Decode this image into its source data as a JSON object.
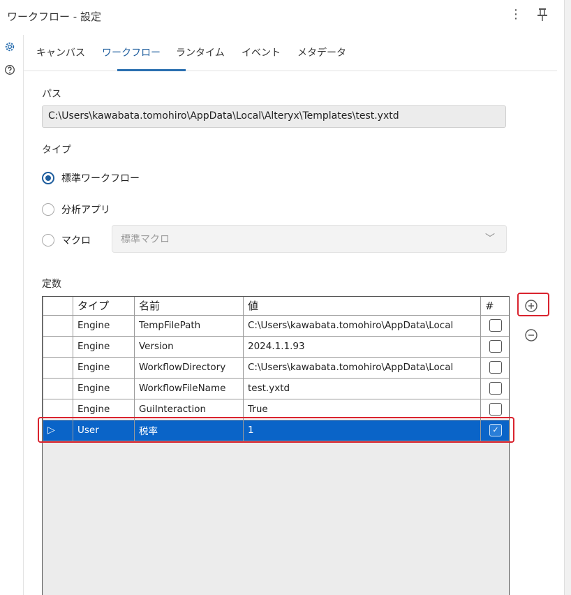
{
  "window": {
    "title": "ワークフロー - 設定"
  },
  "tabs": [
    {
      "label": "キャンバス"
    },
    {
      "label": "ワークフロー"
    },
    {
      "label": "ランタイム"
    },
    {
      "label": "イベント"
    },
    {
      "label": "メタデータ"
    }
  ],
  "path": {
    "label": "パス",
    "value": "C:\\Users\\kawabata.tomohiro\\AppData\\Local\\Alteryx\\Templates\\test.yxtd"
  },
  "type": {
    "label": "タイプ",
    "options": [
      {
        "label": "標準ワークフロー",
        "checked": true
      },
      {
        "label": "分析アプリ",
        "checked": false
      },
      {
        "label": "マクロ",
        "checked": false
      }
    ],
    "macro_select": {
      "value": "標準マクロ"
    }
  },
  "constants": {
    "label": "定数",
    "columns": [
      "タイプ",
      "名前",
      "値",
      "#"
    ],
    "rows": [
      {
        "type": "Engine",
        "name": "TempFilePath",
        "value": "C:\\Users\\kawabata.tomohiro\\AppData\\Local",
        "checked": false
      },
      {
        "type": "Engine",
        "name": "Version",
        "value": "2024.1.1.93",
        "checked": false
      },
      {
        "type": "Engine",
        "name": "WorkflowDirectory",
        "value": "C:\\Users\\kawabata.tomohiro\\AppData\\Local",
        "checked": false
      },
      {
        "type": "Engine",
        "name": "WorkflowFileName",
        "value": "test.yxtd",
        "checked": false
      },
      {
        "type": "Engine",
        "name": "GuiInteraction",
        "value": "True",
        "checked": false
      },
      {
        "type": "User",
        "name": "税率",
        "value": "1",
        "checked": true,
        "selected": true
      }
    ]
  },
  "icons": {
    "more": "more-vertical-icon",
    "pin": "pin-icon",
    "settings": "gear-icon",
    "help": "help-icon",
    "add": "plus-circle-icon",
    "remove": "minus-circle-icon",
    "dropdown": "chevron-down-icon"
  },
  "colors": {
    "accent": "#1f5e9e",
    "selection": "#0a64c8",
    "highlight": "#d9232e"
  }
}
